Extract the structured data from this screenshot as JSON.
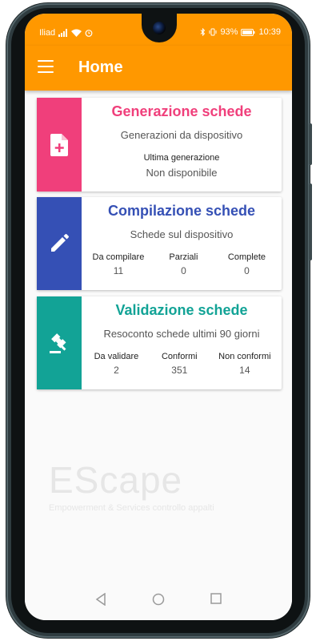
{
  "status": {
    "carrier": "Iliad",
    "battery": "93%",
    "time": "10:39"
  },
  "appbar": {
    "title": "Home",
    "menu_icon": "hamburger-menu-icon"
  },
  "cards": [
    {
      "title": "Generazione schede",
      "subtitle": "Generazioni da dispositivo",
      "color": "#f03f7b",
      "icon": "file-add-icon",
      "single_label": "Ultima generazione",
      "single_value": "Non disponibile"
    },
    {
      "title": "Compilazione schede",
      "subtitle": "Schede sul dispositivo",
      "color": "#3550b5",
      "icon": "pencil-icon",
      "stats": [
        {
          "label": "Da compilare",
          "value": "11"
        },
        {
          "label": "Parziali",
          "value": "0"
        },
        {
          "label": "Complete",
          "value": "0"
        }
      ]
    },
    {
      "title": "Validazione schede",
      "subtitle": "Resoconto schede ultimi 90 giorni",
      "color": "#12a396",
      "icon": "gavel-icon",
      "stats": [
        {
          "label": "Da validare",
          "value": "2"
        },
        {
          "label": "Conformi",
          "value": "351"
        },
        {
          "label": "Non conformi",
          "value": "14"
        }
      ]
    }
  ],
  "watermark": {
    "brand": "EScape",
    "tagline": "Empowerment & Services controllo appalti"
  },
  "colors": {
    "accent": "#ff9800",
    "generazione": "#f03f7b",
    "compilazione": "#3550b5",
    "validazione": "#12a396"
  }
}
